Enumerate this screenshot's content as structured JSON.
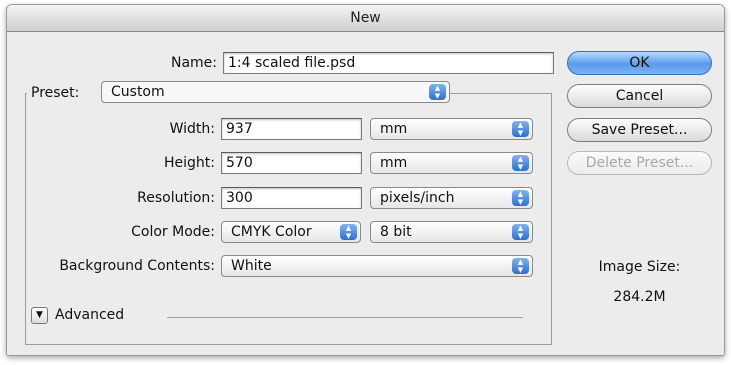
{
  "dialog": {
    "title": "New"
  },
  "name": {
    "label": "Name:",
    "value": "1:4 scaled file.psd"
  },
  "preset": {
    "label": "Preset:",
    "selected": "Custom"
  },
  "width": {
    "label": "Width:",
    "value": "937",
    "unit": "mm"
  },
  "height": {
    "label": "Height:",
    "value": "570",
    "unit": "mm"
  },
  "resolution": {
    "label": "Resolution:",
    "value": "300",
    "unit": "pixels/inch"
  },
  "color_mode": {
    "label": "Color Mode:",
    "selected": "CMYK Color",
    "bit_depth": "8 bit"
  },
  "background": {
    "label": "Background Contents:",
    "selected": "White"
  },
  "advanced": {
    "label": "Advanced"
  },
  "buttons": {
    "ok": "OK",
    "cancel": "Cancel",
    "save_preset": "Save Preset...",
    "delete_preset": "Delete Preset..."
  },
  "image_size": {
    "label": "Image Size:",
    "value": "284.2M"
  },
  "colors": {
    "ok_button": "#5a9bea",
    "popup_arrows": "#2f6fd4"
  }
}
